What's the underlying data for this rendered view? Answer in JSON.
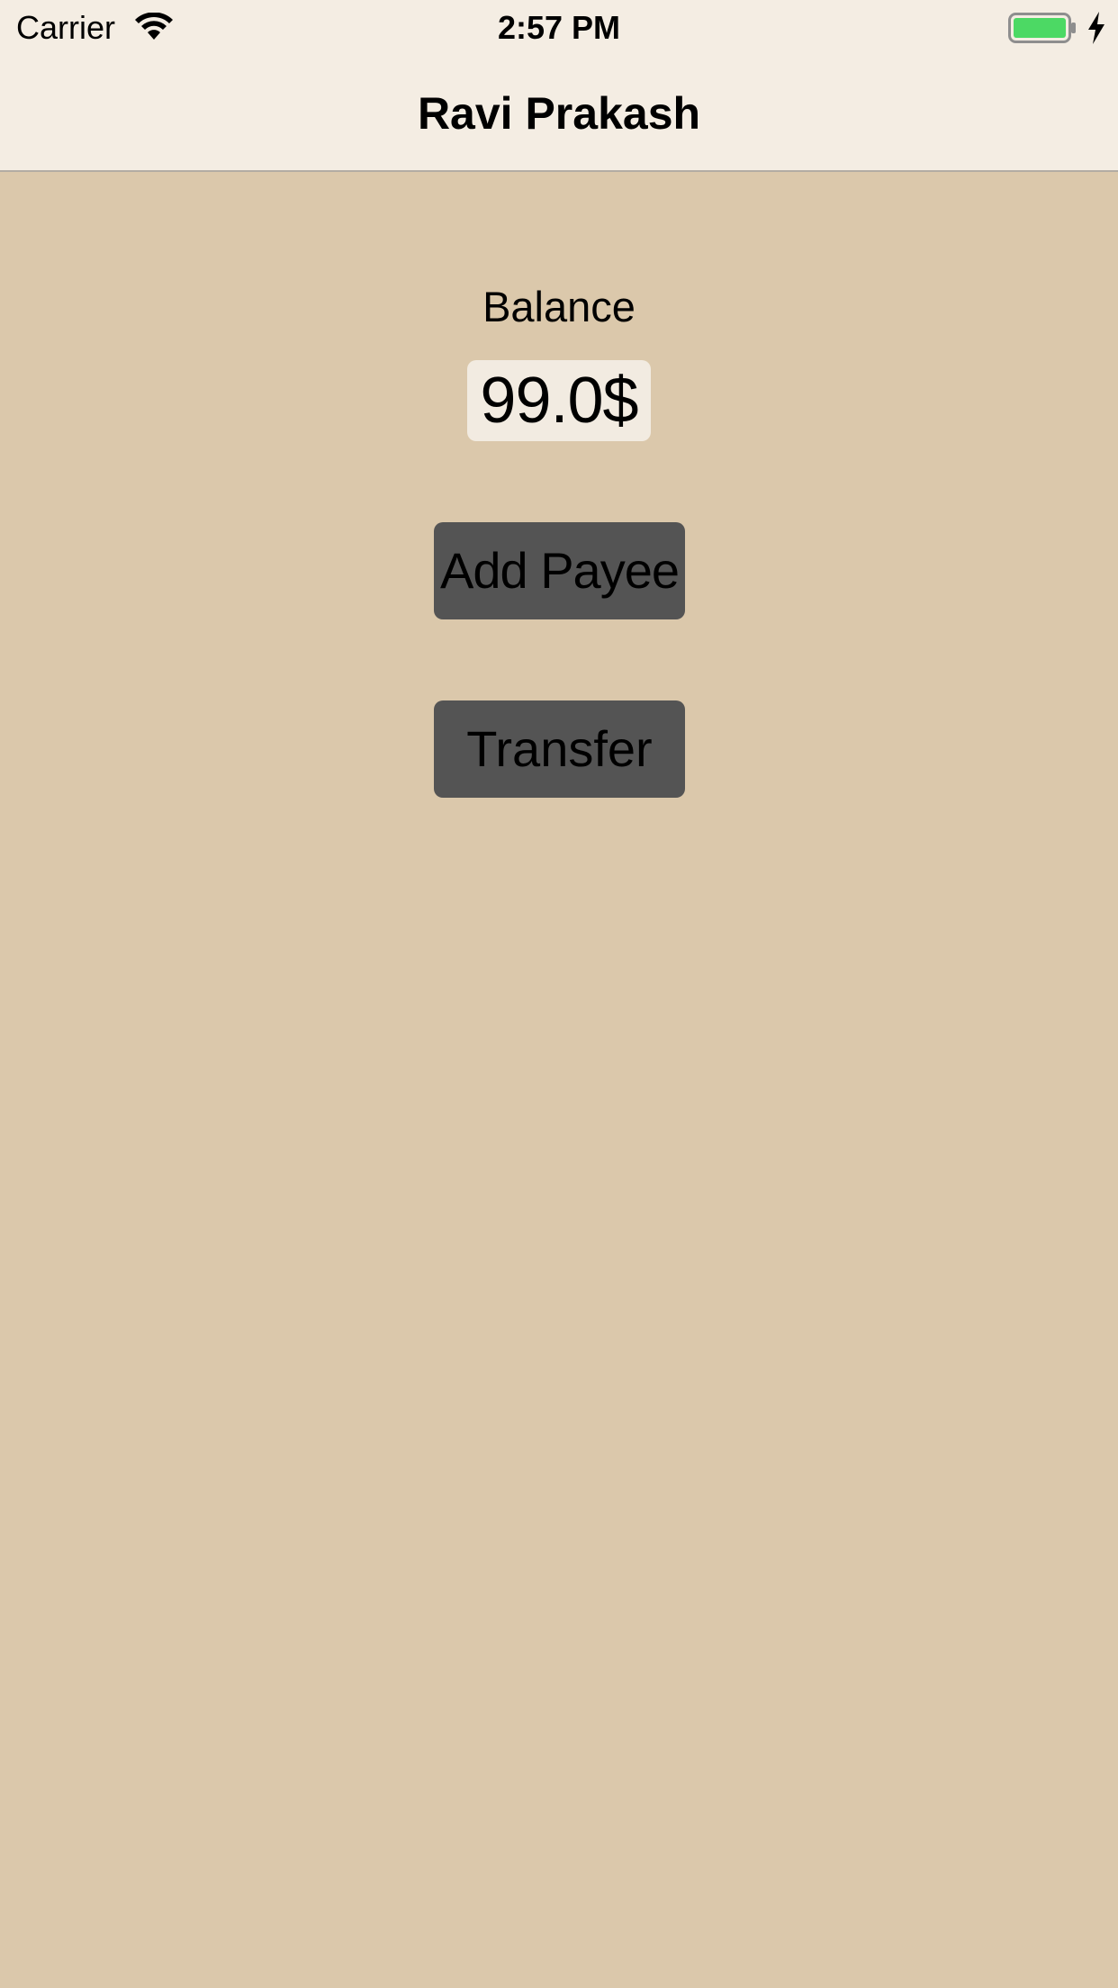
{
  "status_bar": {
    "carrier": "Carrier",
    "time": "2:57 PM",
    "wifi_icon": "wifi-icon",
    "battery_icon": "battery-full-icon",
    "charging_icon": "charging-bolt-icon",
    "battery_color": "#4cd964"
  },
  "nav": {
    "title": "Ravi Prakash"
  },
  "main": {
    "balance_label": "Balance",
    "balance_value": "99.0$",
    "add_payee_label": "Add Payee",
    "transfer_label": "Transfer"
  },
  "colors": {
    "background": "#dbc8ab",
    "nav_background": "#f4ede3",
    "button_background": "#545454",
    "balance_background": "#f2ebe1"
  }
}
